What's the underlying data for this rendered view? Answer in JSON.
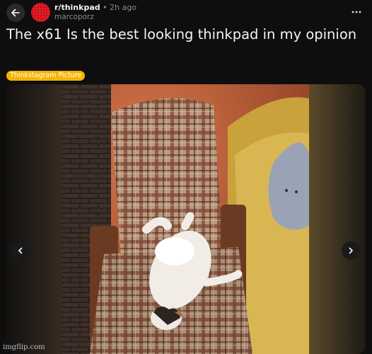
{
  "header": {
    "subreddit": "r/thinkpad",
    "separator": "•",
    "age": "2h ago",
    "author": "marcoporz",
    "back_icon": "arrow-left-icon",
    "more_icon": "more-horizontal-icon"
  },
  "post": {
    "title": "The x61 Is the best looking thinkpad in my opinion",
    "flair": "Thinkstagram Picture",
    "flair_color": "#f5b400"
  },
  "media": {
    "prev_icon": "chevron-left-icon",
    "next_icon": "chevron-right-icon",
    "watermark": "imgflip.com"
  },
  "colors": {
    "background": "#0e0e0e",
    "subreddit_avatar": "#e01b24"
  }
}
